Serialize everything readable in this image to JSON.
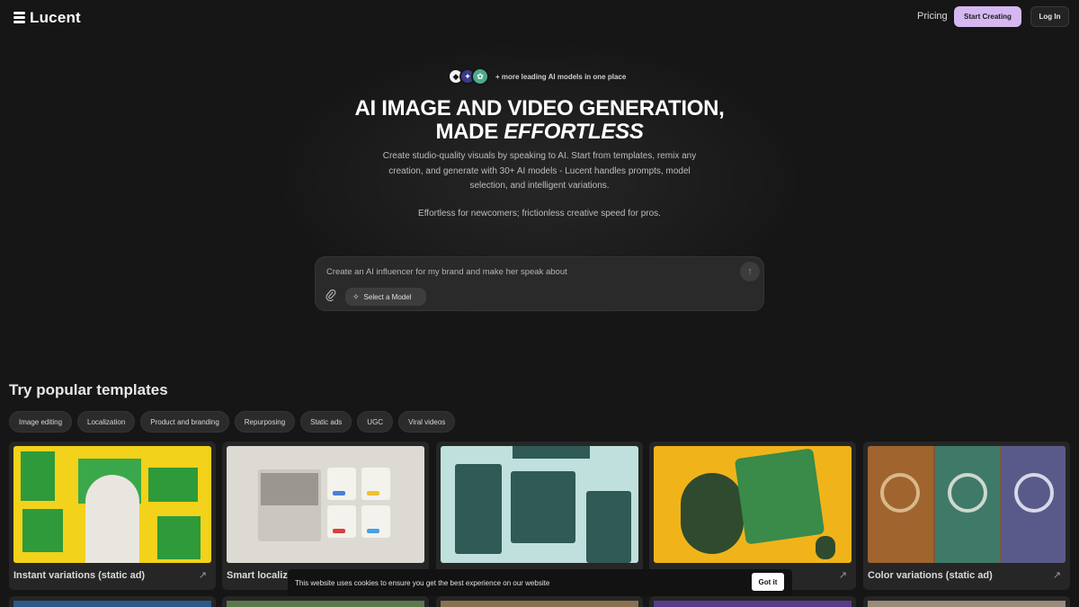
{
  "header": {
    "logo_text": "Lucent",
    "pricing": "Pricing",
    "start_creating": "Start Creating",
    "login": "Log In"
  },
  "hero": {
    "models_text": "+ more leading AI models in one place",
    "title_line1": "AI IMAGE AND VIDEO GENERATION,",
    "title_line2_plain": "MADE ",
    "title_line2_em": "EFFORTLESS",
    "subtitle": "Create studio-quality visuals by speaking to AI. Start from templates, remix any creation, and generate with 30+ AI models - Lucent handles prompts, model selection, and intelligent variations.",
    "subtitle2": "Effortless for newcomers; frictionless creative speed for pros."
  },
  "prompt": {
    "placeholder": "Create an AI influencer for my brand and make her speak about",
    "select_model": "Select a Model"
  },
  "templates": {
    "title": "Try popular templates",
    "chips": [
      "Image editing",
      "Localization",
      "Product and branding",
      "Repurposing",
      "Static ads",
      "UGC",
      "Viral videos"
    ],
    "cards": [
      {
        "label": "Instant variations (static ad)"
      },
      {
        "label": "Smart localiz"
      },
      {
        "label": ""
      },
      {
        "label": ""
      },
      {
        "label": "Color variations (static ad)"
      }
    ]
  },
  "cookie": {
    "text": "This website uses cookies to ensure you get the best experience on our website",
    "button": "Got it"
  },
  "colors": {
    "background": "#161616",
    "accent": "#d5b8f2",
    "card": "#262626"
  }
}
